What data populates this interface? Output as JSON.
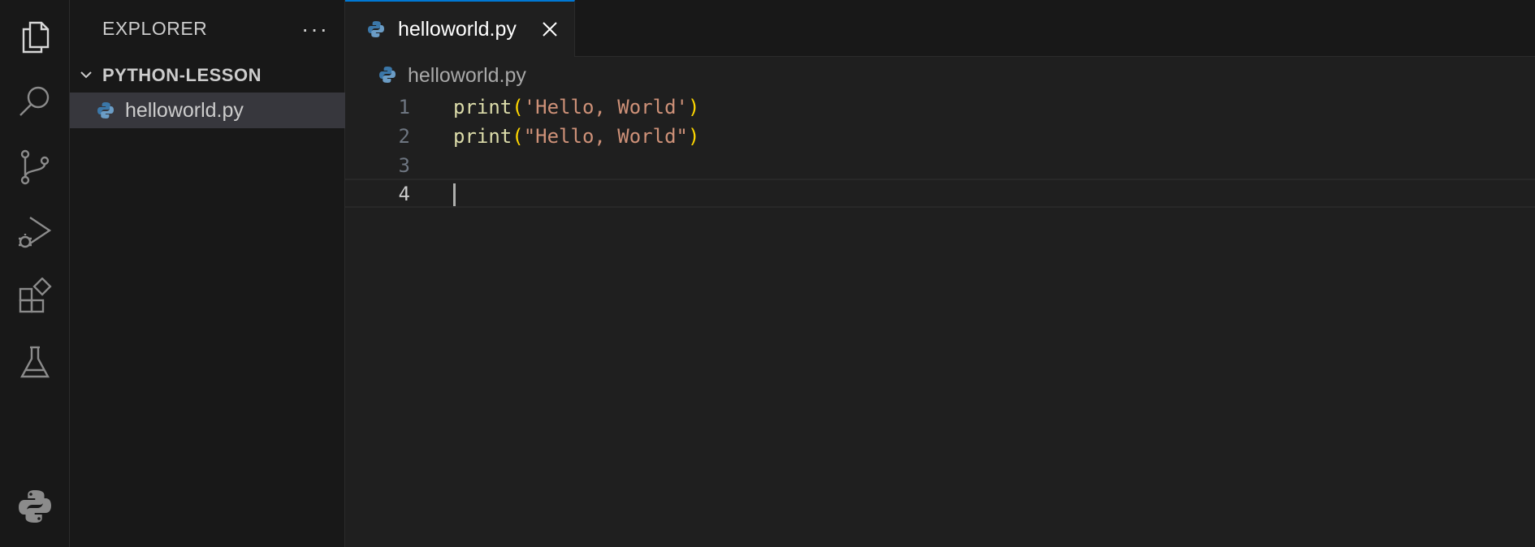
{
  "activity_bar": {
    "items": [
      {
        "name": "explorer",
        "icon": "files-icon"
      },
      {
        "name": "search",
        "icon": "search-icon"
      },
      {
        "name": "source-control",
        "icon": "source-control-icon"
      },
      {
        "name": "run-and-debug",
        "icon": "run-debug-icon"
      },
      {
        "name": "extensions",
        "icon": "extensions-icon"
      },
      {
        "name": "testing",
        "icon": "beaker-icon"
      },
      {
        "name": "python",
        "icon": "python-icon"
      }
    ]
  },
  "sidebar": {
    "title": "EXPLORER",
    "more_label": "···",
    "folder": {
      "label": "PYTHON-LESSON",
      "expanded": true
    },
    "files": [
      {
        "label": "helloworld.py",
        "selected": true,
        "icon": "python-file-icon"
      }
    ]
  },
  "editor": {
    "tab": {
      "label": "helloworld.py",
      "icon": "python-file-icon",
      "close_icon": "close-icon"
    },
    "breadcrumb": {
      "label": "helloworld.py"
    },
    "lines": [
      {
        "number": "1",
        "fn": "print",
        "open": "(",
        "str": "'Hello, World'",
        "close": ")"
      },
      {
        "number": "2",
        "fn": "print",
        "open": "(",
        "str": "\"Hello, World\"",
        "close": ")"
      },
      {
        "number": "3",
        "fn": "",
        "open": "",
        "str": "",
        "close": ""
      },
      {
        "number": "4",
        "fn": "",
        "open": "",
        "str": "",
        "close": ""
      }
    ],
    "current_line": "4"
  },
  "colors": {
    "background": "#1f1f1f",
    "sidebar": "#181818",
    "accent": "#0078d4",
    "selection": "#37373d",
    "function": "#dcdcaa",
    "string": "#ce9178",
    "bracket": "#ffd700",
    "python_blue": "#3b77a8",
    "python_yellow": "#ffd43b"
  }
}
